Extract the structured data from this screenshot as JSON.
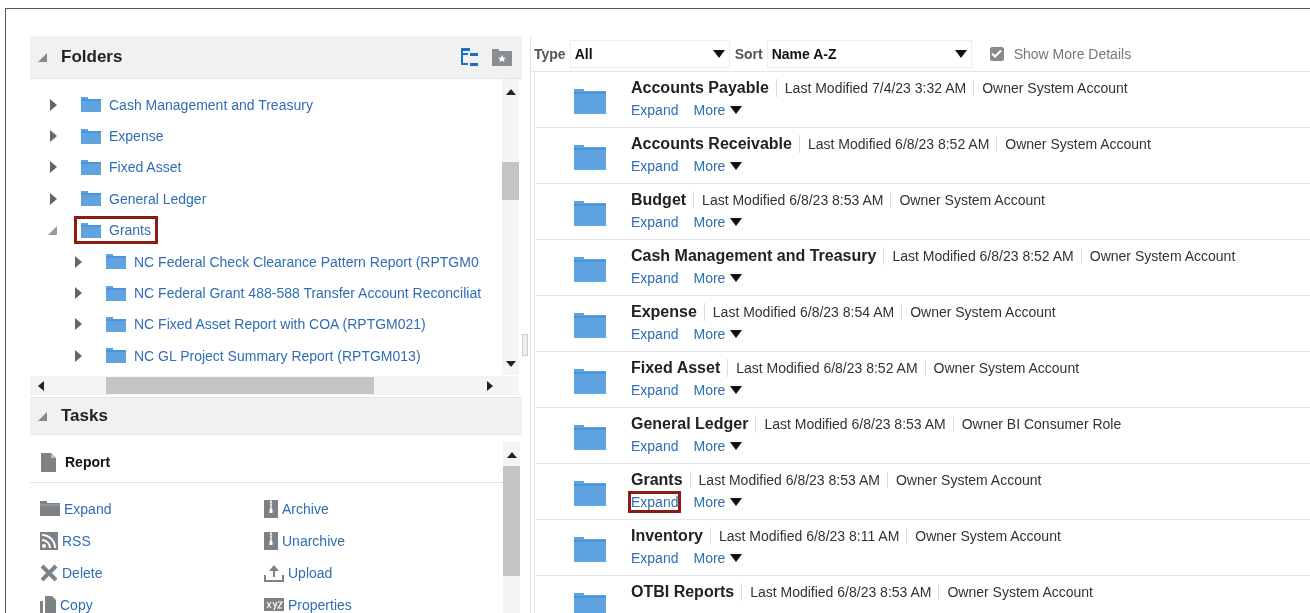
{
  "folders_panel": {
    "title": "Folders",
    "expanded": true,
    "tree": [
      {
        "label": "Cash Management and Treasury",
        "expanded": false,
        "highlighted": false
      },
      {
        "label": "Expense",
        "expanded": false,
        "highlighted": false
      },
      {
        "label": "Fixed Asset",
        "expanded": false,
        "highlighted": false
      },
      {
        "label": "General Ledger",
        "expanded": false,
        "highlighted": false
      },
      {
        "label": "Grants",
        "expanded": true,
        "highlighted": true,
        "children": [
          {
            "label": "NC Federal Check Clearance Pattern Report (RPTGM0",
            "expanded": false,
            "highlighted": false
          },
          {
            "label": "NC Federal Grant 488-588 Transfer Account Reconciliat",
            "expanded": false,
            "highlighted": false
          },
          {
            "label": "NC Fixed Asset Report with COA (RPTGM021)",
            "expanded": false,
            "highlighted": false
          },
          {
            "label": "NC GL Project Summary Report (RPTGM013)",
            "expanded": false,
            "highlighted": false
          }
        ]
      }
    ]
  },
  "tasks_panel": {
    "title": "Tasks",
    "expanded": true,
    "section": "Report",
    "items": [
      {
        "label": "Expand",
        "kind": "expand"
      },
      {
        "label": "Archive",
        "kind": "archive"
      },
      {
        "label": "RSS",
        "kind": "rss"
      },
      {
        "label": "Unarchive",
        "kind": "unarchive"
      },
      {
        "label": "Delete",
        "kind": "delete"
      },
      {
        "label": "Upload",
        "kind": "upload"
      },
      {
        "label": "Copy",
        "kind": "copy"
      },
      {
        "label": "Properties",
        "kind": "properties"
      }
    ]
  },
  "toolbar": {
    "type_label": "Type",
    "type_value": "All",
    "sort_label": "Sort",
    "sort_value": "Name A-Z",
    "show_more_details": {
      "label": "Show More Details",
      "checked": true
    }
  },
  "folders": [
    {
      "name": "Accounts Payable",
      "modified": "Last Modified 7/4/23 3:32 AM",
      "owner": "Owner System Account",
      "expand": "Expand",
      "more": "More",
      "expand_highlighted": false
    },
    {
      "name": "Accounts Receivable",
      "modified": "Last Modified 6/8/23 8:52 AM",
      "owner": "Owner System Account",
      "expand": "Expand",
      "more": "More",
      "expand_highlighted": false
    },
    {
      "name": "Budget",
      "modified": "Last Modified 6/8/23 8:53 AM",
      "owner": "Owner System Account",
      "expand": "Expand",
      "more": "More",
      "expand_highlighted": false
    },
    {
      "name": "Cash Management and Treasury",
      "modified": "Last Modified 6/8/23 8:52 AM",
      "owner": "Owner System Account",
      "expand": "Expand",
      "more": "More",
      "expand_highlighted": false
    },
    {
      "name": "Expense",
      "modified": "Last Modified 6/8/23 8:54 AM",
      "owner": "Owner System Account",
      "expand": "Expand",
      "more": "More",
      "expand_highlighted": false
    },
    {
      "name": "Fixed Asset",
      "modified": "Last Modified 6/8/23 8:52 AM",
      "owner": "Owner System Account",
      "expand": "Expand",
      "more": "More",
      "expand_highlighted": false
    },
    {
      "name": "General Ledger",
      "modified": "Last Modified 6/8/23 8:53 AM",
      "owner": "Owner BI Consumer Role",
      "expand": "Expand",
      "more": "More",
      "expand_highlighted": false
    },
    {
      "name": "Grants",
      "modified": "Last Modified 6/8/23 8:53 AM",
      "owner": "Owner System Account",
      "expand": "Expand",
      "more": "More",
      "expand_highlighted": true
    },
    {
      "name": "Inventory",
      "modified": "Last Modified 6/8/23 8:11 AM",
      "owner": "Owner System Account",
      "expand": "Expand",
      "more": "More",
      "expand_highlighted": false
    },
    {
      "name": "OTBI Reports",
      "modified": "Last Modified 6/8/23 8:53 AM",
      "owner": "Owner System Account"
    }
  ]
}
